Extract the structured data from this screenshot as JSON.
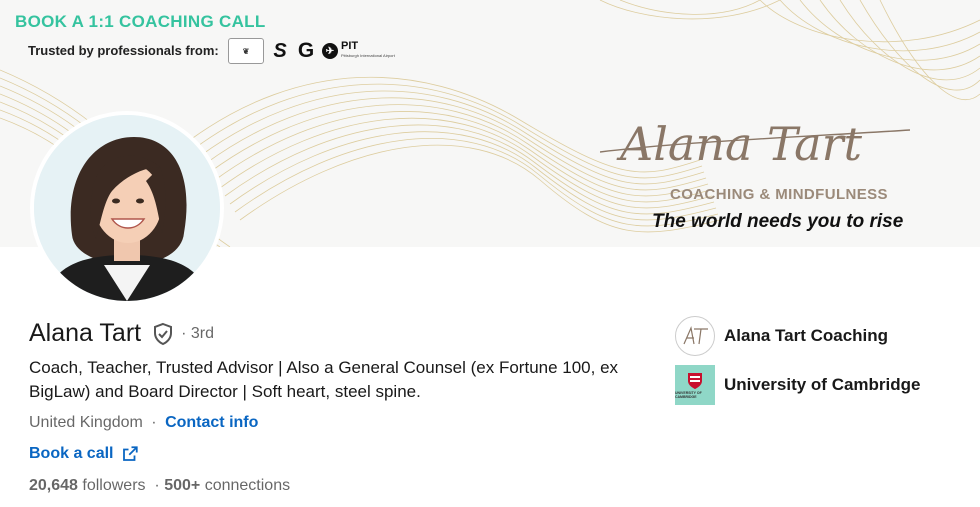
{
  "banner": {
    "cta": "BOOK A 1:1 COACHING CALL",
    "trusted_label": "Trusted by professionals from:",
    "logos": [
      "crest-logo",
      "s-logo",
      "g-logo",
      "pit-logo"
    ],
    "pit_text": "PIT",
    "pit_sub": "Pittsburgh International Airport",
    "signature": "Alana Tart",
    "brand_sub": "COACHING & MINDFULNESS",
    "tagline": "The world needs you to rise",
    "colors": {
      "cta": "#35c39f",
      "gold": "#d8c48a",
      "brand_sub": "#9b8a7a"
    }
  },
  "profile": {
    "name": "Alana Tart",
    "verified_icon": "shield-check-icon",
    "degree": "· 3rd",
    "headline": "Coach, Teacher, Trusted Advisor | Also a General Counsel (ex Fortune 100, ex BigLaw) and Board Director | Soft heart, steel spine.",
    "location": "United Kingdom",
    "separator": "·",
    "contact_label": "Contact info",
    "book_label": "Book a call",
    "followers_count": "20,648",
    "followers_label": "followers",
    "connections_prefix": "·",
    "connections_count": "500+",
    "connections_label": "connections"
  },
  "orgs": [
    {
      "name": "Alana Tart Coaching",
      "logo": "at-monogram-logo"
    },
    {
      "name": "University of Cambridge",
      "logo": "cambridge-crest-logo",
      "logo_text": "UNIVERSITY OF CAMBRIDGE"
    }
  ],
  "colors": {
    "link": "#0a66c2",
    "muted": "rgba(0,0,0,0.6)"
  }
}
